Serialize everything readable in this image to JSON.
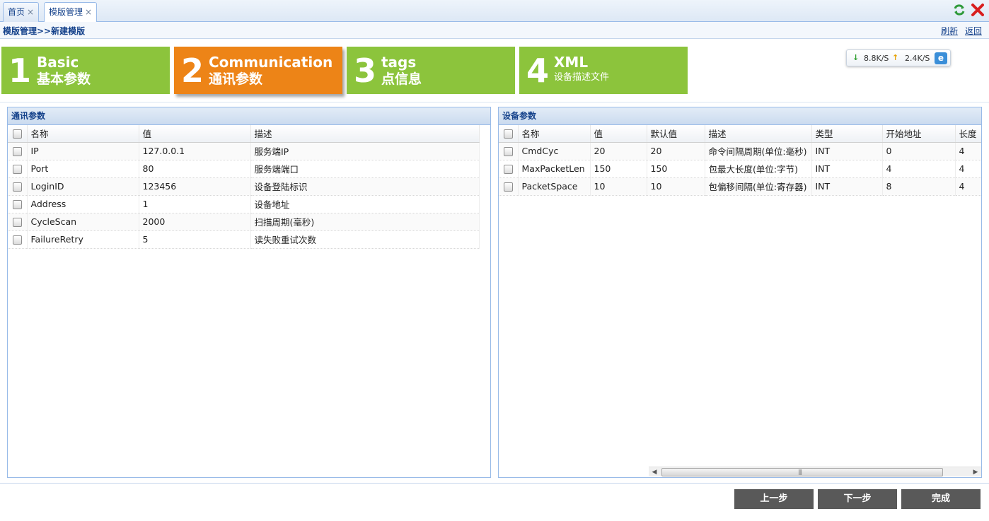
{
  "tabs": [
    {
      "label": "首页",
      "close": "×"
    },
    {
      "label": "模版管理",
      "close": "×"
    }
  ],
  "breadcrumb": {
    "path": "模版管理>>新建模版",
    "refresh": "刷新",
    "back": "返回"
  },
  "steps": [
    {
      "num": "1",
      "en": "Basic",
      "cn": "基本参数",
      "active": false
    },
    {
      "num": "2",
      "en": "Communication",
      "cn": "通讯参数",
      "active": true
    },
    {
      "num": "3",
      "en": "tags",
      "cn": "点信息",
      "active": false
    },
    {
      "num": "4",
      "en": "XML",
      "cn": "设备描述文件",
      "active": false
    }
  ],
  "speed": {
    "down": "8.8K/S",
    "up": "2.4K/S"
  },
  "comm_panel": {
    "title": "通讯参数",
    "columns": [
      "名称",
      "值",
      "描述"
    ],
    "rows": [
      [
        "IP",
        "127.0.0.1",
        "服务端IP"
      ],
      [
        "Port",
        "80",
        "服务端端口"
      ],
      [
        "LoginID",
        "123456",
        "设备登陆标识"
      ],
      [
        "Address",
        "1",
        "设备地址"
      ],
      [
        "CycleScan",
        "2000",
        "扫描周期(毫秒)"
      ],
      [
        "FailureRetry",
        "5",
        "读失败重试次数"
      ]
    ]
  },
  "device_panel": {
    "title": "设备参数",
    "columns": [
      "名称",
      "值",
      "默认值",
      "描述",
      "类型",
      "开始地址",
      "长度"
    ],
    "rows": [
      [
        "CmdCyc",
        "20",
        "20",
        "命令间隔周期(单位:毫秒)",
        "INT",
        "0",
        "4"
      ],
      [
        "MaxPacketLen",
        "150",
        "150",
        "包最大长度(单位:字节)",
        "INT",
        "4",
        "4"
      ],
      [
        "PacketSpace",
        "10",
        "10",
        "包偏移间隔(单位:寄存器)",
        "INT",
        "8",
        "4"
      ]
    ]
  },
  "buttons": {
    "prev": "上一步",
    "next": "下一步",
    "done": "完成"
  },
  "colors": {
    "step_green": "#8cc43c",
    "step_orange": "#ed8417",
    "header_blue": "#15428b",
    "button_gray": "#595959"
  }
}
